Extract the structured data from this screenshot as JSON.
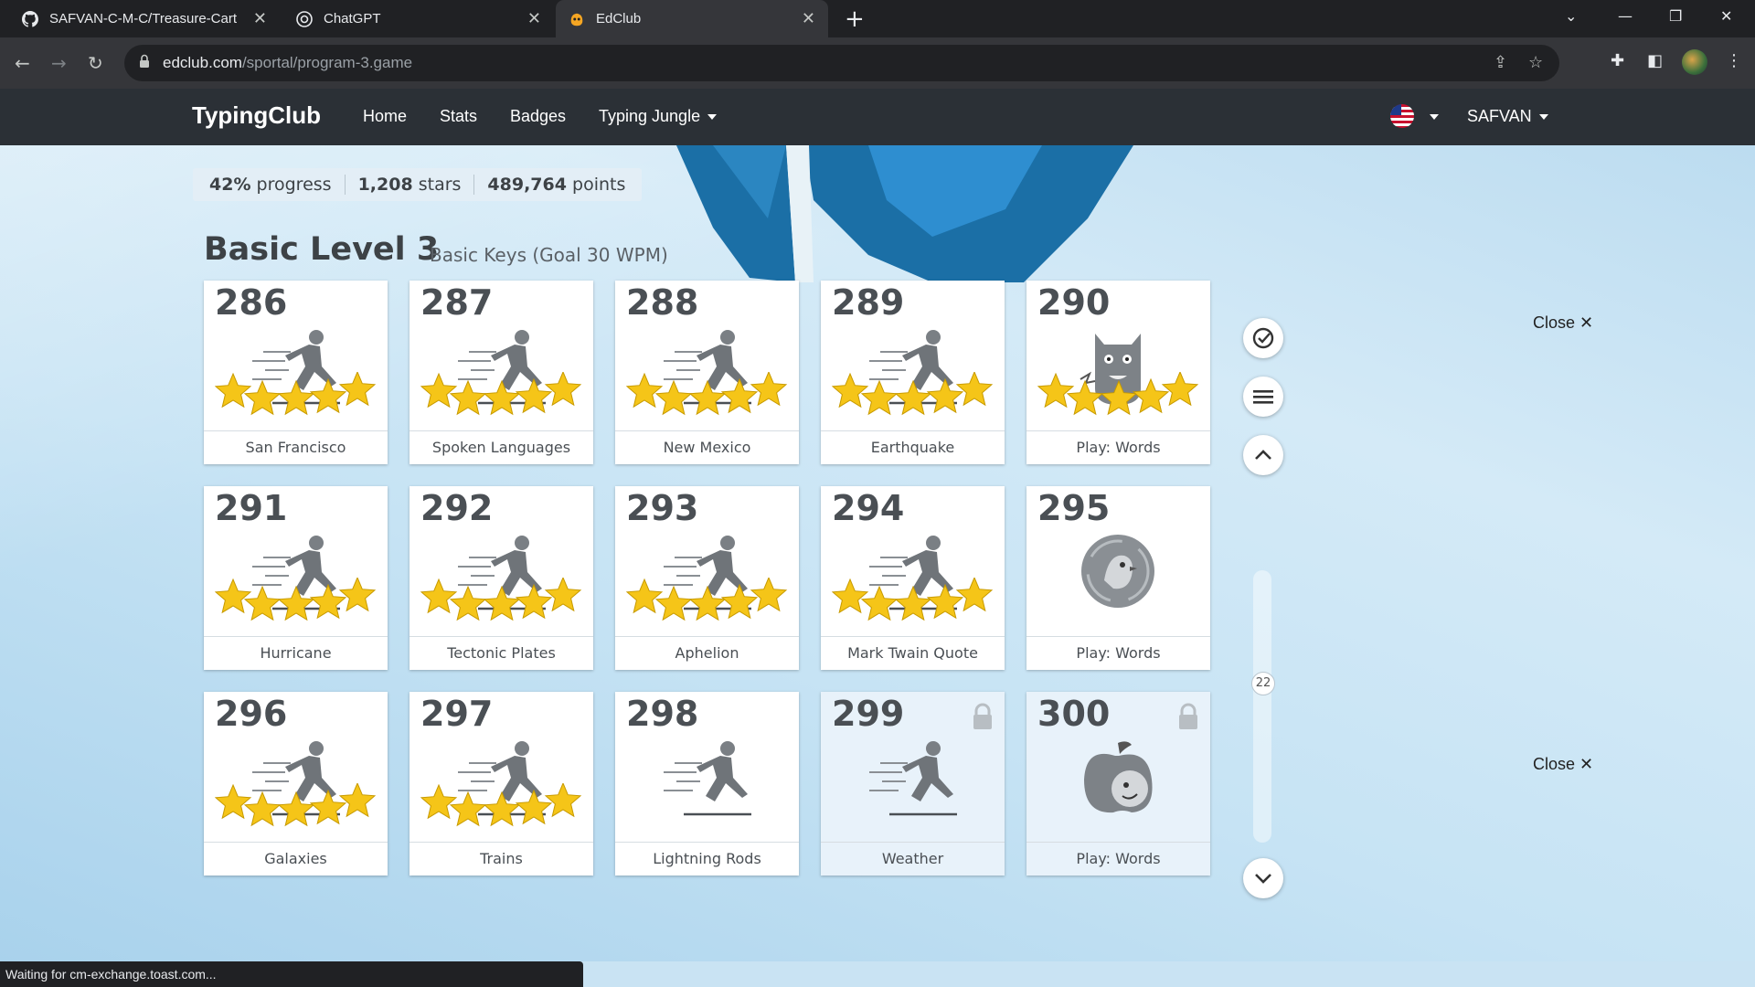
{
  "browser": {
    "tabs": [
      {
        "title": "SAFVAN-C-M-C/Treasure-Cart",
        "icon": "github-icon"
      },
      {
        "title": "ChatGPT",
        "icon": "chatgpt-icon"
      },
      {
        "title": "EdClub",
        "icon": "edclub-icon"
      }
    ],
    "url_domain": "edclub.com",
    "url_path": "/sportal/program-3.game"
  },
  "header": {
    "brand": "TypingClub",
    "nav": [
      "Home",
      "Stats",
      "Badges",
      "Typing Jungle"
    ],
    "user": "SAFVAN"
  },
  "stats": {
    "progress_value": "42%",
    "progress_label": "progress",
    "stars_value": "1,208",
    "stars_label": "stars",
    "points_value": "489,764",
    "points_label": "points"
  },
  "level": {
    "title": "Basic Level 3",
    "subtitle": "Basic Keys (Goal 30 WPM)"
  },
  "lessons": [
    {
      "num": "286",
      "name": "San Francisco",
      "kind": "runner",
      "stars": 5,
      "locked": false
    },
    {
      "num": "287",
      "name": "Spoken Languages",
      "kind": "runner",
      "stars": 5,
      "locked": false
    },
    {
      "num": "288",
      "name": "New Mexico",
      "kind": "runner",
      "stars": 5,
      "locked": false
    },
    {
      "num": "289",
      "name": "Earthquake",
      "kind": "runner",
      "stars": 5,
      "locked": false
    },
    {
      "num": "290",
      "name": "Play: Words",
      "kind": "monster",
      "stars": 5,
      "locked": false
    },
    {
      "num": "291",
      "name": "Hurricane",
      "kind": "runner",
      "stars": 5,
      "locked": false
    },
    {
      "num": "292",
      "name": "Tectonic Plates",
      "kind": "runner",
      "stars": 5,
      "locked": false
    },
    {
      "num": "293",
      "name": "Aphelion",
      "kind": "runner",
      "stars": 5,
      "locked": false
    },
    {
      "num": "294",
      "name": "Mark Twain Quote",
      "kind": "runner",
      "stars": 5,
      "locked": false
    },
    {
      "num": "295",
      "name": "Play: Words",
      "kind": "bird",
      "stars": 0,
      "locked": false
    },
    {
      "num": "296",
      "name": "Galaxies",
      "kind": "runner",
      "stars": 5,
      "locked": false
    },
    {
      "num": "297",
      "name": "Trains",
      "kind": "runner",
      "stars": 5,
      "locked": false
    },
    {
      "num": "298",
      "name": "Lightning Rods",
      "kind": "runner",
      "stars": 0,
      "locked": false
    },
    {
      "num": "299",
      "name": "Weather",
      "kind": "runner",
      "stars": 0,
      "locked": true
    },
    {
      "num": "300",
      "name": "Play: Words",
      "kind": "apple",
      "stars": 0,
      "locked": true
    }
  ],
  "scroller": {
    "value": "22"
  },
  "close_label": "Close",
  "status_text": "Waiting for cm-exchange.toast.com...",
  "colors": {
    "accent_header": "#2b3036",
    "star": "#f5c518"
  }
}
